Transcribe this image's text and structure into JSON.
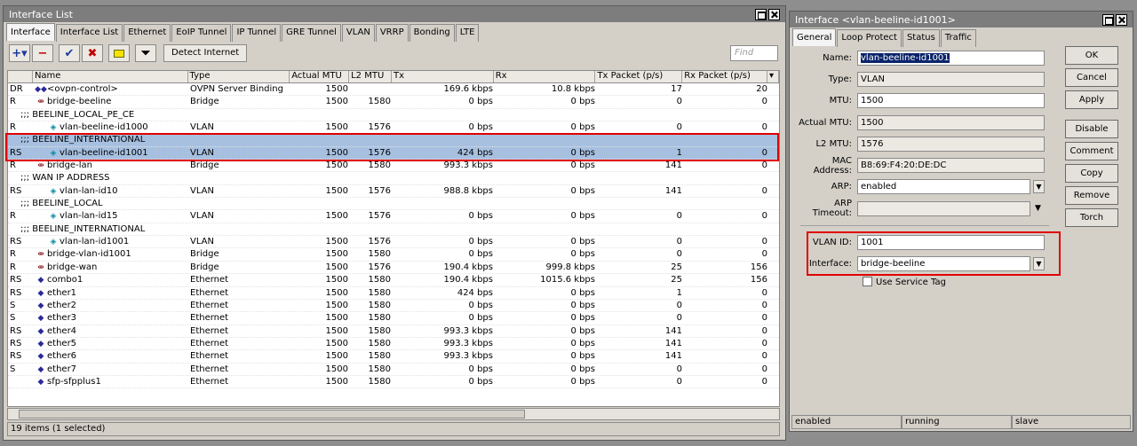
{
  "list_window": {
    "title": "Interface List",
    "tabs": [
      "Interface",
      "Interface List",
      "Ethernet",
      "EoIP Tunnel",
      "IP Tunnel",
      "GRE Tunnel",
      "VLAN",
      "VRRP",
      "Bonding",
      "LTE"
    ],
    "detect_label": "Detect Internet",
    "find_placeholder": "Find",
    "headers": [
      "",
      "Name",
      "Type",
      "Actual MTU",
      "L2 MTU",
      "Tx",
      "Rx",
      "Tx Packet (p/s)",
      "Rx Packet (p/s)"
    ],
    "rows": [
      {
        "flag": "DR",
        "icon": "ovpn-icon",
        "name": "<ovpn-control>",
        "type": "OVPN Server Binding",
        "mtu": "1500",
        "l2": "",
        "tx": "169.6 kbps",
        "rx": "10.8 kbps",
        "txp": "17",
        "rxp": "20"
      },
      {
        "flag": "R",
        "icon": "bridge-icon",
        "name": "bridge-beeline",
        "type": "Bridge",
        "mtu": "1500",
        "l2": "1580",
        "tx": "0 bps",
        "rx": "0 bps",
        "txp": "0",
        "rxp": "0"
      },
      {
        "comment": ";;; BEELINE_LOCAL_PE_CE"
      },
      {
        "flag": "R",
        "icon": "vlan-icon",
        "indent": true,
        "name": "vlan-beeline-id1000",
        "type": "VLAN",
        "mtu": "1500",
        "l2": "1576",
        "tx": "0 bps",
        "rx": "0 bps",
        "txp": "0",
        "rxp": "0"
      },
      {
        "comment": ";;; BEELINE_INTERNATIONAL",
        "sel": true
      },
      {
        "flag": "RS",
        "icon": "vlan-icon",
        "indent": true,
        "name": "vlan-beeline-id1001",
        "type": "VLAN",
        "mtu": "1500",
        "l2": "1576",
        "tx": "424 bps",
        "rx": "0 bps",
        "txp": "1",
        "rxp": "0",
        "sel": true
      },
      {
        "flag": "R",
        "icon": "bridge-icon",
        "name": "bridge-lan",
        "type": "Bridge",
        "mtu": "1500",
        "l2": "1580",
        "tx": "993.3 kbps",
        "rx": "0 bps",
        "txp": "141",
        "rxp": "0"
      },
      {
        "comment": ";;; WAN IP ADDRESS"
      },
      {
        "flag": "RS",
        "icon": "vlan-icon",
        "indent": true,
        "name": "vlan-lan-id10",
        "type": "VLAN",
        "mtu": "1500",
        "l2": "1576",
        "tx": "988.8 kbps",
        "rx": "0 bps",
        "txp": "141",
        "rxp": "0"
      },
      {
        "comment": ";;; BEELINE_LOCAL"
      },
      {
        "flag": "R",
        "icon": "vlan-icon",
        "indent": true,
        "name": "vlan-lan-id15",
        "type": "VLAN",
        "mtu": "1500",
        "l2": "1576",
        "tx": "0 bps",
        "rx": "0 bps",
        "txp": "0",
        "rxp": "0"
      },
      {
        "comment": ";;; BEELINE_INTERNATIONAL"
      },
      {
        "flag": "RS",
        "icon": "vlan-icon",
        "indent": true,
        "name": "vlan-lan-id1001",
        "type": "VLAN",
        "mtu": "1500",
        "l2": "1576",
        "tx": "0 bps",
        "rx": "0 bps",
        "txp": "0",
        "rxp": "0"
      },
      {
        "flag": "R",
        "icon": "bridge-icon",
        "name": "bridge-vlan-id1001",
        "type": "Bridge",
        "mtu": "1500",
        "l2": "1580",
        "tx": "0 bps",
        "rx": "0 bps",
        "txp": "0",
        "rxp": "0"
      },
      {
        "flag": "R",
        "icon": "bridge-icon",
        "name": "bridge-wan",
        "type": "Bridge",
        "mtu": "1500",
        "l2": "1576",
        "tx": "190.4 kbps",
        "rx": "999.8 kbps",
        "txp": "25",
        "rxp": "156"
      },
      {
        "flag": "RS",
        "icon": "ethernet-icon",
        "name": "combo1",
        "type": "Ethernet",
        "mtu": "1500",
        "l2": "1580",
        "tx": "190.4 kbps",
        "rx": "1015.6 kbps",
        "txp": "25",
        "rxp": "156"
      },
      {
        "flag": "RS",
        "icon": "ethernet-icon",
        "name": "ether1",
        "type": "Ethernet",
        "mtu": "1500",
        "l2": "1580",
        "tx": "424 bps",
        "rx": "0 bps",
        "txp": "1",
        "rxp": "0"
      },
      {
        "flag": "S",
        "icon": "ethernet-icon",
        "name": "ether2",
        "type": "Ethernet",
        "mtu": "1500",
        "l2": "1580",
        "tx": "0 bps",
        "rx": "0 bps",
        "txp": "0",
        "rxp": "0"
      },
      {
        "flag": "S",
        "icon": "ethernet-icon",
        "name": "ether3",
        "type": "Ethernet",
        "mtu": "1500",
        "l2": "1580",
        "tx": "0 bps",
        "rx": "0 bps",
        "txp": "0",
        "rxp": "0"
      },
      {
        "flag": "RS",
        "icon": "ethernet-icon",
        "name": "ether4",
        "type": "Ethernet",
        "mtu": "1500",
        "l2": "1580",
        "tx": "993.3 kbps",
        "rx": "0 bps",
        "txp": "141",
        "rxp": "0"
      },
      {
        "flag": "RS",
        "icon": "ethernet-icon",
        "name": "ether5",
        "type": "Ethernet",
        "mtu": "1500",
        "l2": "1580",
        "tx": "993.3 kbps",
        "rx": "0 bps",
        "txp": "141",
        "rxp": "0"
      },
      {
        "flag": "RS",
        "icon": "ethernet-icon",
        "name": "ether6",
        "type": "Ethernet",
        "mtu": "1500",
        "l2": "1580",
        "tx": "993.3 kbps",
        "rx": "0 bps",
        "txp": "141",
        "rxp": "0"
      },
      {
        "flag": "S",
        "icon": "ethernet-icon",
        "name": "ether7",
        "type": "Ethernet",
        "mtu": "1500",
        "l2": "1580",
        "tx": "0 bps",
        "rx": "0 bps",
        "txp": "0",
        "rxp": "0"
      },
      {
        "flag": "",
        "icon": "ethernet-icon",
        "name": "sfp-sfpplus1",
        "type": "Ethernet",
        "mtu": "1500",
        "l2": "1580",
        "tx": "0 bps",
        "rx": "0 bps",
        "txp": "0",
        "rxp": "0"
      }
    ],
    "status": "19 items (1 selected)"
  },
  "detail_window": {
    "title": "Interface <vlan-beeline-id1001>",
    "tabs": [
      "General",
      "Loop Protect",
      "Status",
      "Traffic"
    ],
    "fields": {
      "name": {
        "label": "Name:",
        "value": "vlan-beeline-id1001"
      },
      "type": {
        "label": "Type:",
        "value": "VLAN"
      },
      "mtu": {
        "label": "MTU:",
        "value": "1500"
      },
      "actual_mtu": {
        "label": "Actual MTU:",
        "value": "1500"
      },
      "l2mtu": {
        "label": "L2 MTU:",
        "value": "1576"
      },
      "mac": {
        "label": "MAC Address:",
        "value": "B8:69:F4:20:DE:DC"
      },
      "arp": {
        "label": "ARP:",
        "value": "enabled"
      },
      "arp_timeout": {
        "label": "ARP Timeout:",
        "value": ""
      },
      "vlan_id": {
        "label": "VLAN ID:",
        "value": "1001"
      },
      "interface": {
        "label": "Interface:",
        "value": "bridge-beeline"
      },
      "service_tag": {
        "label": "Use Service Tag"
      }
    },
    "buttons": [
      "OK",
      "Cancel",
      "Apply",
      "Disable",
      "Comment",
      "Copy",
      "Remove",
      "Torch"
    ],
    "status": [
      "enabled",
      "running",
      "slave"
    ]
  },
  "colors": {
    "highlight_box": "#e00000",
    "selected_row": "#a7c0e0"
  }
}
